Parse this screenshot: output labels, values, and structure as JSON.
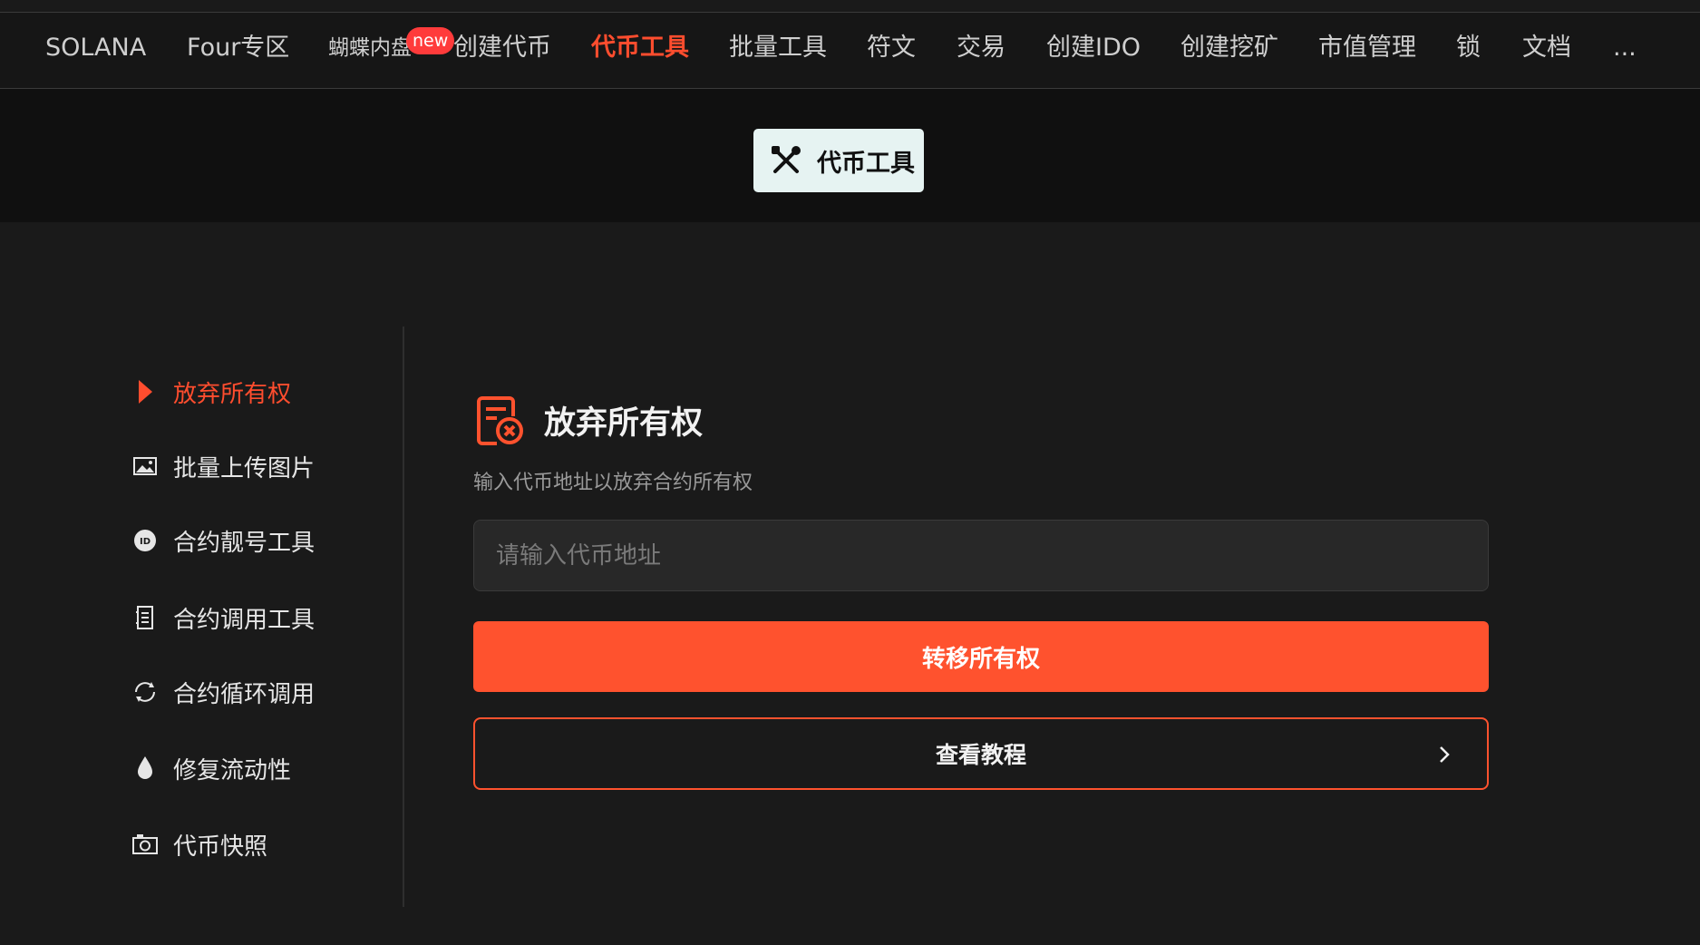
{
  "nav": {
    "items": [
      {
        "label": "SOLANA"
      },
      {
        "label": "Four专区"
      },
      {
        "label": "蝴蝶内盘",
        "badge": "new"
      },
      {
        "label": "创建代币"
      },
      {
        "label": "代币工具",
        "active": true
      },
      {
        "label": "批量工具"
      },
      {
        "label": "符文"
      },
      {
        "label": "交易"
      },
      {
        "label": "创建IDO"
      },
      {
        "label": "创建挖矿"
      },
      {
        "label": "市值管理"
      },
      {
        "label": "锁"
      },
      {
        "label": "文档"
      },
      {
        "label": "..."
      }
    ]
  },
  "banner": {
    "label": "代币工具",
    "icon": "tools-icon"
  },
  "sidebar": {
    "items": [
      {
        "label": "放弃所有权",
        "icon": "play-arrow-icon",
        "active": true
      },
      {
        "label": "批量上传图片",
        "icon": "image-icon"
      },
      {
        "label": "合约靓号工具",
        "icon": "id-badge-icon"
      },
      {
        "label": "合约调用工具",
        "icon": "ledger-icon"
      },
      {
        "label": "合约循环调用",
        "icon": "refresh-icon"
      },
      {
        "label": "修复流动性",
        "icon": "drop-icon"
      },
      {
        "label": "代币快照",
        "icon": "camera-icon"
      }
    ]
  },
  "main": {
    "title": "放弃所有权",
    "title_icon": "document-cancel-icon",
    "subtitle": "输入代币地址以放弃合约所有权",
    "address_input": {
      "placeholder": "请输入代币地址",
      "value": ""
    },
    "primary_button": "转移所有权",
    "secondary_button": "查看教程"
  },
  "colors": {
    "accent": "#ff522e",
    "background": "#1a1a1a",
    "banner_background": "#101010",
    "chip_background": "#e6f3f2"
  }
}
